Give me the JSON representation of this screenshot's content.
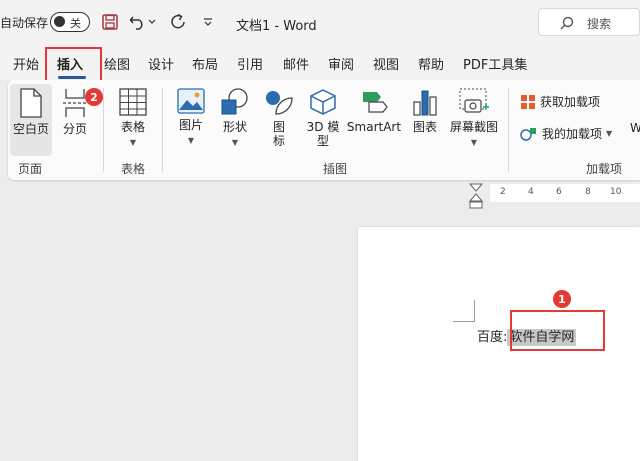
{
  "titlebar": {
    "autosave_label": "自动保存",
    "toggle_text": "关",
    "doc_title": "文档1  -  Word",
    "search_placeholder": "搜索"
  },
  "tabs": [
    "开始",
    "插入",
    "绘图",
    "设计",
    "布局",
    "引用",
    "邮件",
    "审阅",
    "视图",
    "帮助",
    "PDF工具集"
  ],
  "ribbon": {
    "blank_page": "空白页",
    "page_break": "分页",
    "group_pages": "页面",
    "table": "表格",
    "group_tables": "表格",
    "pictures": "图片",
    "shapes": "形状",
    "icons_line1": "图",
    "icons_line2": "标",
    "model_line1": "3D 模",
    "model_line2": "型",
    "smartart": "SmartArt",
    "chart": "图表",
    "screenshot": "屏幕截图",
    "group_illustrations": "插图",
    "get_addins": "获取加载项",
    "my_addins": "我的加载项",
    "overflow": "W",
    "group_addins": "加载项"
  },
  "ruler": [
    "2",
    "4",
    "6",
    "8",
    "10"
  ],
  "document": {
    "prefix": "百度:",
    "selected": "软件自学网"
  },
  "annotations": {
    "badge1": "1",
    "badge2": "2"
  },
  "colors": {
    "accent": "#2b579a",
    "highlight": "#e53935",
    "save_icon": "#a4373a"
  }
}
